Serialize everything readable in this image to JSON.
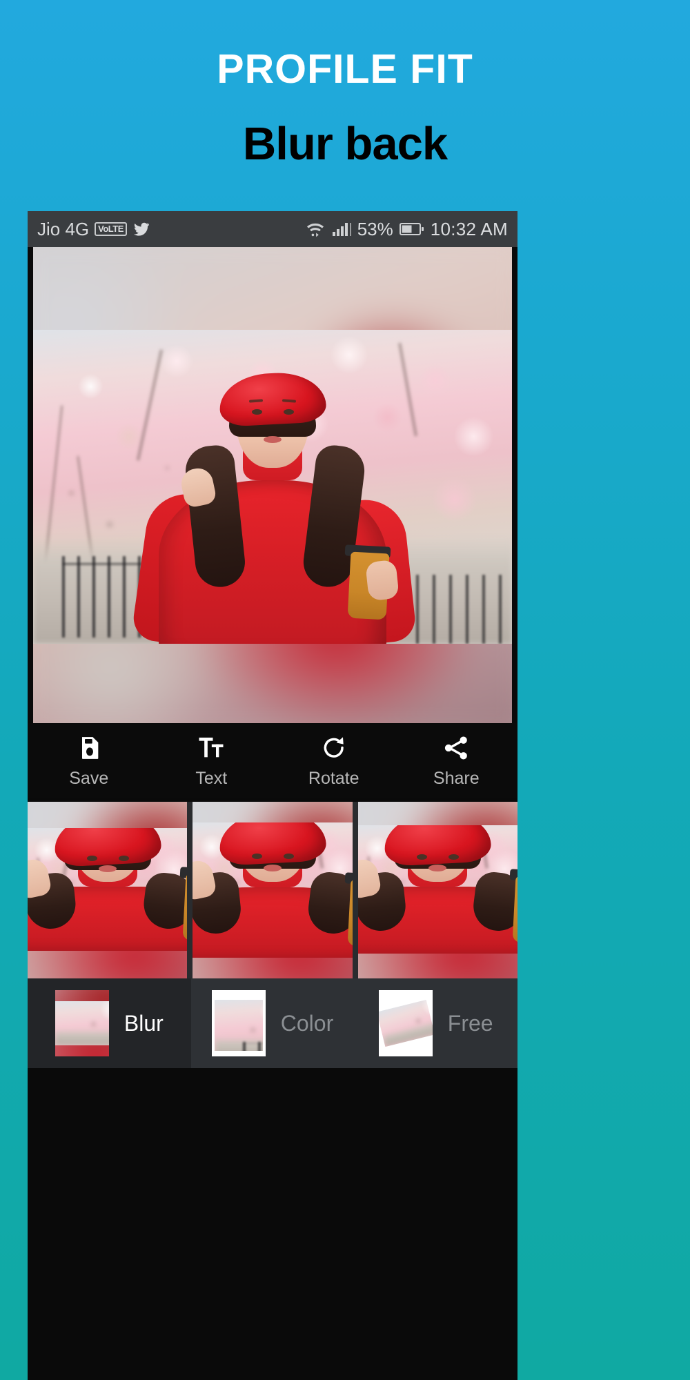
{
  "promo": {
    "title": "PROFILE FIT",
    "subtitle": "Blur back",
    "background_top_color": "#22a9de",
    "background_bottom_color": "#10a9a2",
    "title_color": "#ffffff",
    "subtitle_color": "#000000"
  },
  "status_bar": {
    "carrier": "Jio 4G",
    "volte_badge": "VoLTE",
    "twitter_icon": "twitter-icon",
    "wifi_icon": "wifi-icon",
    "signal_icon": "signal-bars-icon",
    "battery_percent": "53%",
    "battery_icon": "battery-icon",
    "clock": "10:32 AM",
    "background_color": "#3a3d40",
    "text_color": "#d9dbdd"
  },
  "toolbar": {
    "items": [
      {
        "label": "Save",
        "icon": "save-floppy-icon"
      },
      {
        "label": "Text",
        "icon": "text-format-icon"
      },
      {
        "label": "Rotate",
        "icon": "rotate-clockwise-icon"
      },
      {
        "label": "Share",
        "icon": "share-nodes-icon"
      }
    ],
    "background_color": "#0b0b0b",
    "label_color": "#b7b7b7",
    "icon_color": "#ffffff"
  },
  "preview_strip": {
    "items": [
      {
        "name": "preview-blur-1"
      },
      {
        "name": "preview-blur-2"
      },
      {
        "name": "preview-blur-3"
      }
    ],
    "background_color": "#2a2c2f"
  },
  "mode_bar": {
    "items": [
      {
        "label": "Blur",
        "active": true
      },
      {
        "label": "Color",
        "active": false
      },
      {
        "label": "Free",
        "active": false
      }
    ],
    "active_color": "#ffffff",
    "inactive_color": "#8b8f93",
    "background_color": "#2e3135",
    "active_background_color": "#232528"
  }
}
